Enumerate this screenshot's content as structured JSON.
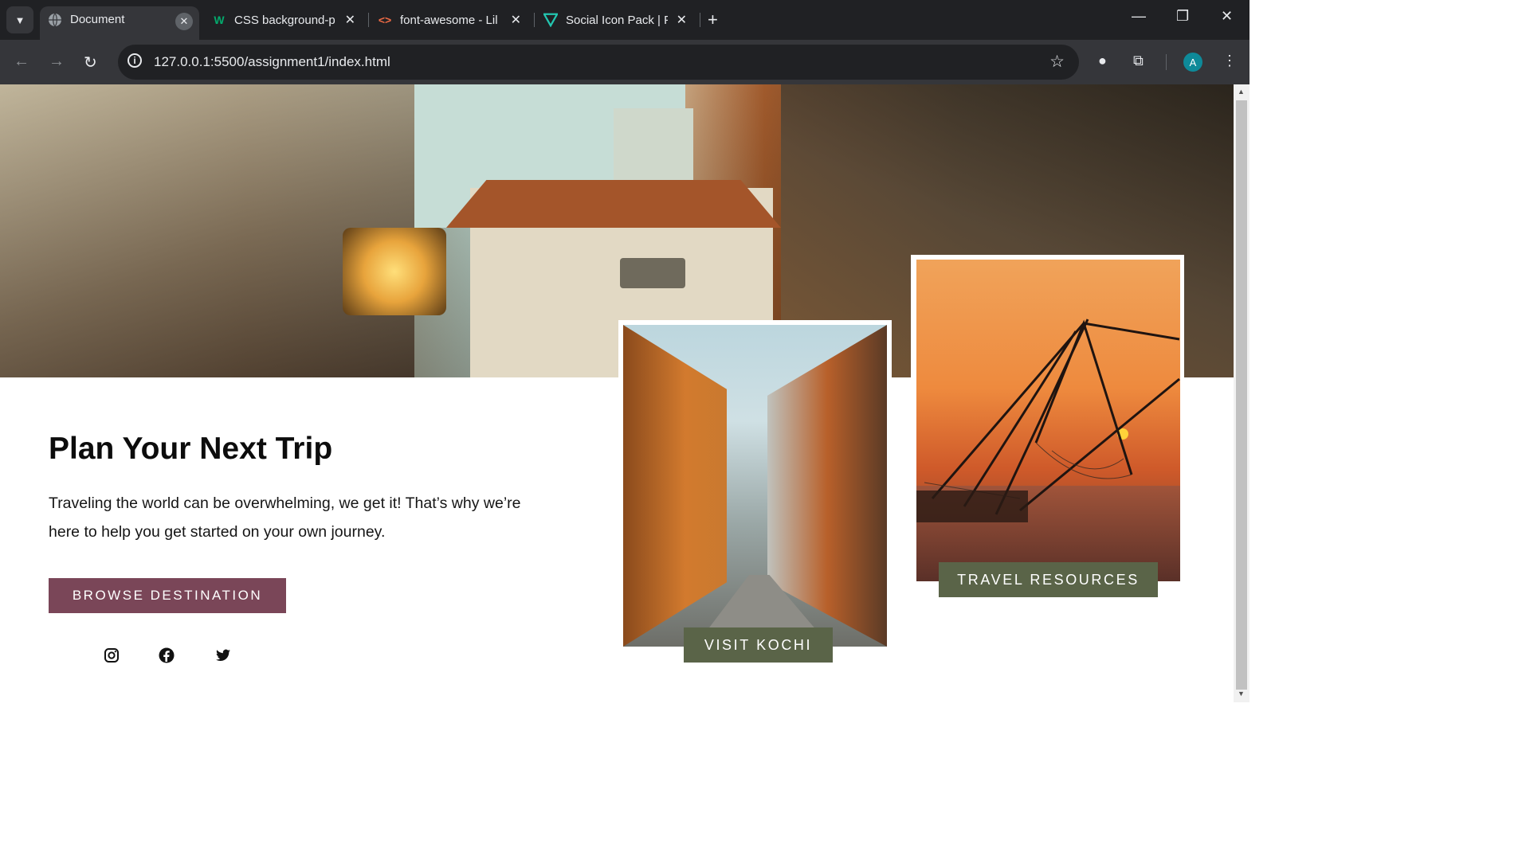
{
  "browser": {
    "tabs": [
      {
        "title": "Document",
        "favicon": "globe-icon",
        "active": true
      },
      {
        "title": "CSS background-p",
        "favicon": "w3schools-icon",
        "active": false
      },
      {
        "title": "font-awesome - Lil",
        "favicon": "code-icon",
        "active": false
      },
      {
        "title": "Social Icon Pack | F",
        "favicon": "v-logo-icon",
        "active": false
      }
    ],
    "url": "127.0.0.1:5500/assignment1/index.html",
    "profile_initial": "A",
    "colors": {
      "frame": "#202124",
      "toolbar": "#35363a",
      "text": "#e8eaed",
      "avatar": "#0e8a99"
    }
  },
  "page": {
    "headline": "Plan Your Next Trip",
    "intro": "Traveling the world can be overwhelming, we get it! That’s why we’re here to help you get started on your own journey.",
    "browse_label": "BROWSE DESTINATION",
    "visit_label": "VISIT KOCHI",
    "resources_label": "TRAVEL RESOURCES",
    "social": [
      "instagram-icon",
      "facebook-icon",
      "twitter-icon"
    ],
    "colors": {
      "browse_button": "#7a4658",
      "card_button": "#5a6448",
      "heading": "#0c0c0c"
    }
  }
}
